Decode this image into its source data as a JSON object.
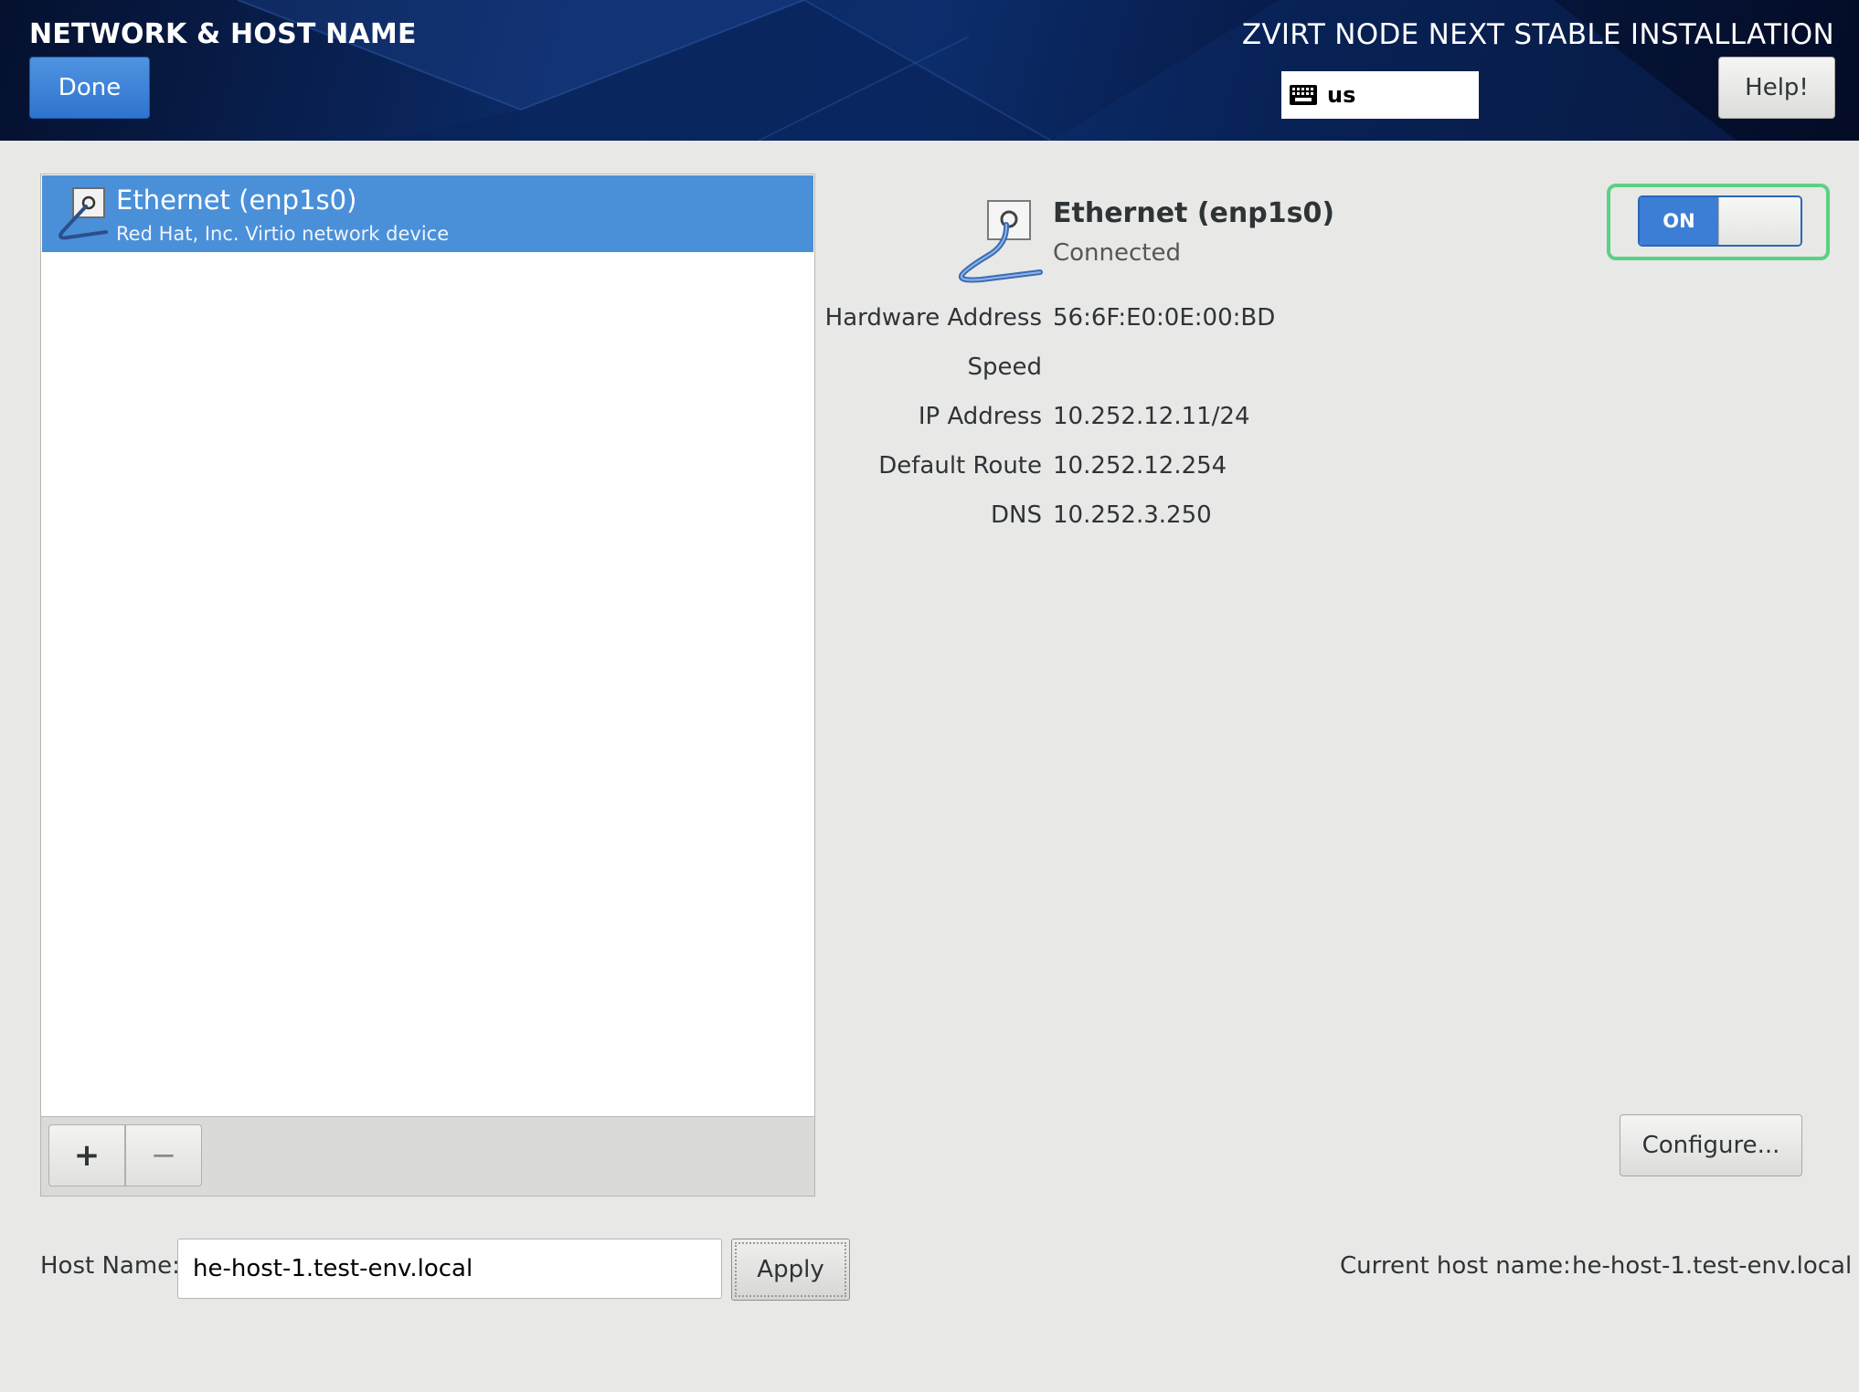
{
  "header": {
    "spoke_title": "NETWORK & HOST NAME",
    "done_label": "Done",
    "product_title": "ZVIRT NODE NEXT STABLE INSTALLATION",
    "keyboard_layout": "us",
    "help_label": "Help!"
  },
  "devices": [
    {
      "name": "Ethernet (enp1s0)",
      "description": "Red Hat, Inc. Virtio network device",
      "selected": true
    }
  ],
  "toolbar": {
    "add_label": "+",
    "remove_label": "−"
  },
  "details": {
    "name": "Ethernet (enp1s0)",
    "status": "Connected",
    "switch_label": "ON",
    "fields": [
      {
        "label": "Hardware Address",
        "value": "56:6F:E0:0E:00:BD"
      },
      {
        "label": "Speed",
        "value": ""
      },
      {
        "label": "IP Address",
        "value": "10.252.12.11/24"
      },
      {
        "label": "Default Route",
        "value": "10.252.12.254"
      },
      {
        "label": "DNS",
        "value": "10.252.3.250"
      }
    ],
    "configure_label": "Configure..."
  },
  "hostname": {
    "label": "Host Name:",
    "value": "he-host-1.test-env.local",
    "apply_label": "Apply",
    "current_label": "Current host name:",
    "current_value": "he-host-1.test-env.local"
  },
  "colors": {
    "accent": "#4a90d9",
    "switch_highlight": "#5bd184"
  },
  "icons": {
    "keyboard": "keyboard-icon",
    "network": "network-wired-icon"
  }
}
